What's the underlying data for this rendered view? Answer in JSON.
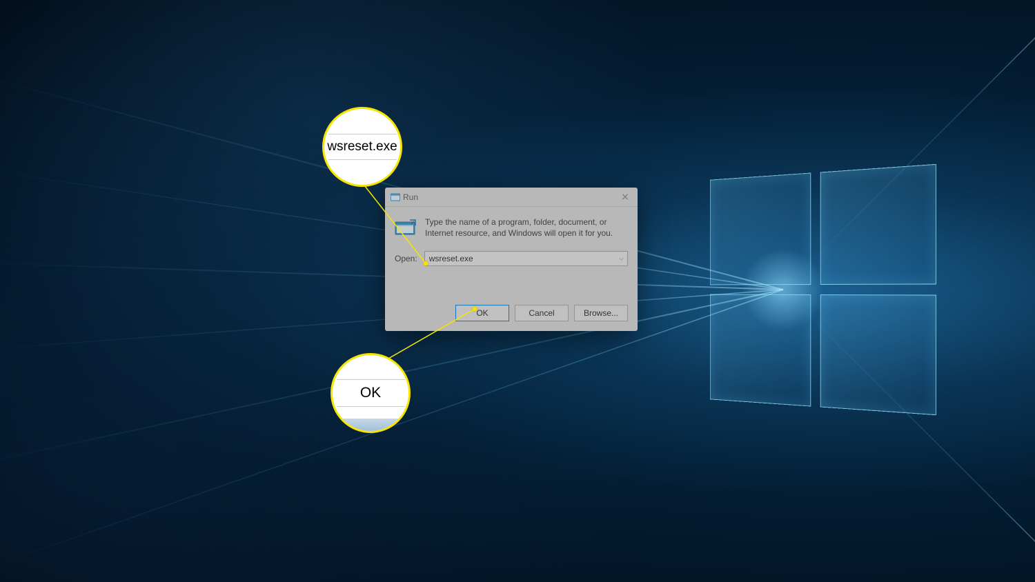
{
  "dialog": {
    "title": "Run",
    "instruction": "Type the name of a program, folder, document, or Internet resource, and Windows will open it for you.",
    "open_label": "Open:",
    "input_value": "wsreset.exe",
    "buttons": {
      "ok": "OK",
      "cancel": "Cancel",
      "browse": "Browse..."
    }
  },
  "callouts": {
    "input_zoom": "wsreset.exe",
    "ok_zoom": "OK"
  }
}
